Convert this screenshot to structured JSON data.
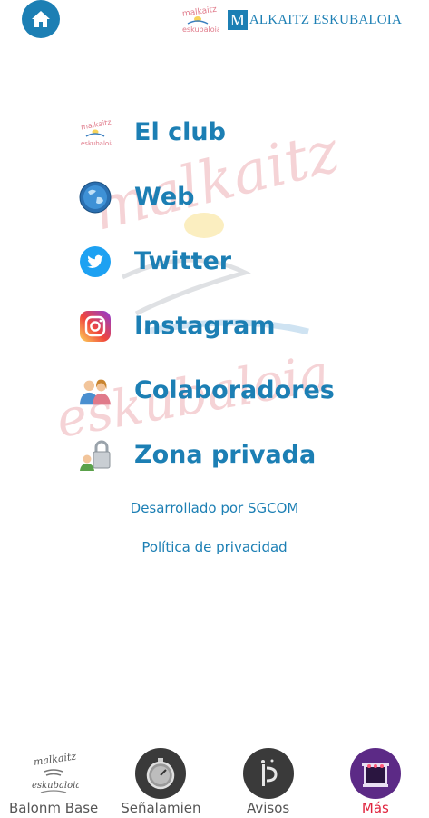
{
  "header": {
    "brand_mark": "M",
    "brand_name": "ALKAITZ ESKUBALOIA"
  },
  "watermark": {
    "top": "malkaitz",
    "bottom": "eskubaloia"
  },
  "menu": [
    {
      "label": "El club",
      "icon": "club-logo-icon"
    },
    {
      "label": "Web",
      "icon": "globe-icon"
    },
    {
      "label": "Twitter",
      "icon": "twitter-icon"
    },
    {
      "label": "Instagram",
      "icon": "instagram-icon"
    },
    {
      "label": "Colaboradores",
      "icon": "people-icon"
    },
    {
      "label": "Zona privada",
      "icon": "lock-user-icon"
    }
  ],
  "links": {
    "developer": "Desarrollado por SGCOM",
    "privacy": "Política de privacidad"
  },
  "tabs": [
    {
      "label": "Balonm Base",
      "icon": "club-logo-icon"
    },
    {
      "label": "Señalamien",
      "icon": "stopwatch-icon"
    },
    {
      "label": "Avisos",
      "icon": "notice-icon"
    },
    {
      "label": "Más",
      "icon": "more-icon",
      "active": true
    }
  ],
  "colors": {
    "primary": "#1c7fb4",
    "active_tab": "#e0233d",
    "watermark": "#f3c8cc"
  }
}
